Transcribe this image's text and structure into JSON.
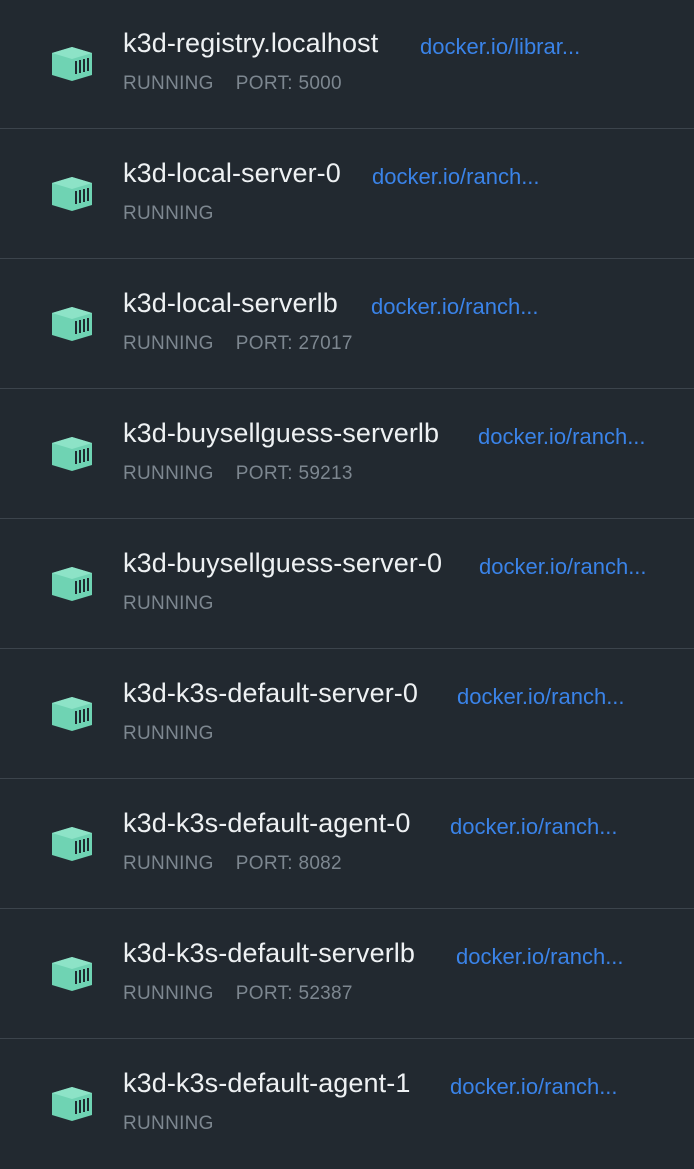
{
  "containers": [
    {
      "name": "k3d-registry.localhost",
      "image": "docker.io/librar...",
      "status": "RUNNING",
      "port": "PORT: 5000"
    },
    {
      "name": "k3d-local-server-0",
      "image": "docker.io/ranch...",
      "status": "RUNNING",
      "port": ""
    },
    {
      "name": "k3d-local-serverlb",
      "image": "docker.io/ranch...",
      "status": "RUNNING",
      "port": "PORT: 27017"
    },
    {
      "name": "k3d-buysellguess-serverlb",
      "image": "docker.io/ranch...",
      "status": "RUNNING",
      "port": "PORT: 59213"
    },
    {
      "name": "k3d-buysellguess-server-0",
      "image": "docker.io/ranch...",
      "status": "RUNNING",
      "port": ""
    },
    {
      "name": "k3d-k3s-default-server-0",
      "image": "docker.io/ranch...",
      "status": "RUNNING",
      "port": ""
    },
    {
      "name": "k3d-k3s-default-agent-0",
      "image": "docker.io/ranch...",
      "status": "RUNNING",
      "port": "PORT: 8082"
    },
    {
      "name": "k3d-k3s-default-serverlb",
      "image": "docker.io/ranch...",
      "status": "RUNNING",
      "port": "PORT: 52387"
    },
    {
      "name": "k3d-k3s-default-agent-1",
      "image": "docker.io/ranch...",
      "status": "RUNNING",
      "port": ""
    }
  ],
  "icon": "container-icon",
  "colors": {
    "background": "#222930",
    "divider": "#3c444c",
    "icon": "#6fd3b3",
    "link": "#3a83e8",
    "status": "#7d8790"
  }
}
